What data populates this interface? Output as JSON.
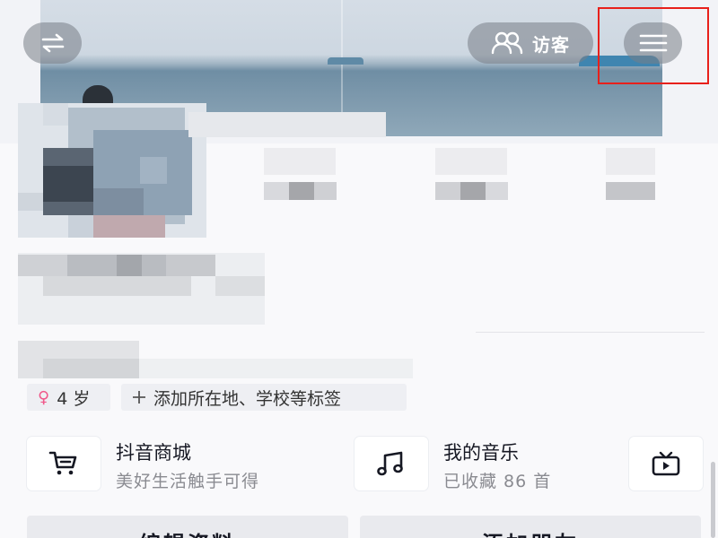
{
  "header": {
    "visitor_label": "访客",
    "icons": {
      "switch": "switch-arrows-icon",
      "visitor": "people-icon",
      "menu": "hamburger-menu-icon"
    }
  },
  "profile": {
    "tags": [
      {
        "icon": "female-icon",
        "label": "4 岁"
      },
      {
        "icon": "plus-icon",
        "label": "添加所在地、学校等标签"
      }
    ]
  },
  "features": [
    {
      "icon": "shopping-cart-icon",
      "title": "抖音商城",
      "subtitle": "美好生活触手可得"
    },
    {
      "icon": "music-note-icon",
      "title": "我的音乐",
      "subtitle": "已收藏 86 首"
    },
    {
      "icon": "tv-icon"
    }
  ],
  "actions": {
    "edit_profile": "编辑资料",
    "add_friends": "添加朋友"
  },
  "colors": {
    "highlight_border": "#e8201b",
    "female_pink": "#f0588a",
    "overlay_button": "#787e86"
  }
}
